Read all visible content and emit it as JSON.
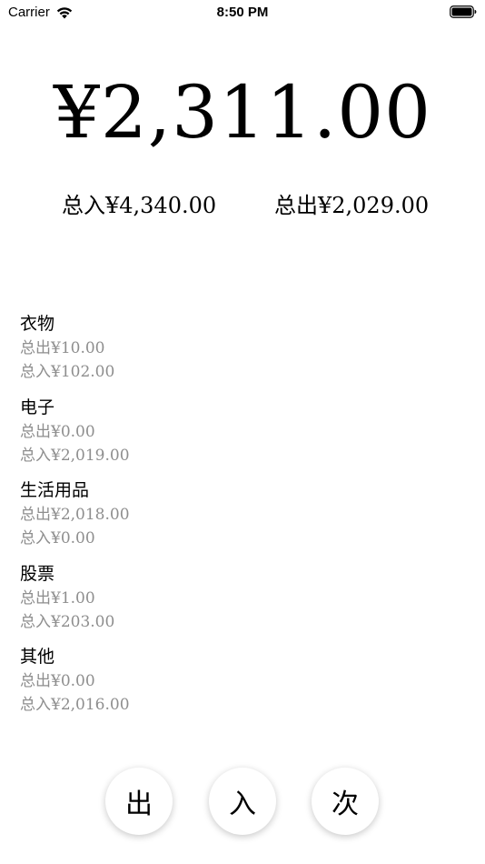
{
  "status_bar": {
    "carrier": "Carrier",
    "time": "8:50 PM"
  },
  "summary": {
    "balance": "¥2,311.00",
    "total_in": "总入¥4,340.00",
    "total_out": "总出¥2,029.00"
  },
  "categories": [
    {
      "name": "衣物",
      "out": "总出¥10.00",
      "in": "总入¥102.00"
    },
    {
      "name": "电子",
      "out": "总出¥0.00",
      "in": "总入¥2,019.00"
    },
    {
      "name": "生活用品",
      "out": "总出¥2,018.00",
      "in": "总入¥0.00"
    },
    {
      "name": "股票",
      "out": "总出¥1.00",
      "in": "总入¥203.00"
    },
    {
      "name": "其他",
      "out": "总出¥0.00",
      "in": "总入¥2,016.00"
    }
  ],
  "actions": {
    "out_label": "出",
    "in_label": "入",
    "count_label": "次"
  },
  "icons": {
    "wifi": "wifi-icon",
    "battery": "battery-icon"
  }
}
